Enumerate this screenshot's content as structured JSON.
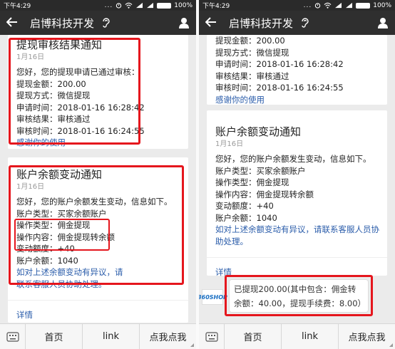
{
  "status_bar": {
    "time": "下午4:29",
    "dots": "...",
    "battery": "100%"
  },
  "nav": {
    "back_icon": "arrow-left",
    "title": "启博科技开发",
    "ear_icon": "ear",
    "profile_icon": "person"
  },
  "left": {
    "card1": {
      "title": "提现审核结果通知",
      "date": "1月16日",
      "lines": [
        "您好，您的提现申请已通过审核：",
        "提现金额：200.00",
        "提现方式：微信提现",
        "申请时间：2018-01-16 16:28:42",
        "审核结果：审核通过",
        "审核时间：2018-01-16 16:24:55"
      ],
      "thanks": "感谢你的使用"
    },
    "card2": {
      "title": "账户余额变动通知",
      "date": "1月16日",
      "lines": [
        "您好，您的账户余额发生变动，信息如下。",
        "账户类型：买家余额账户",
        "操作类型：佣金提现",
        "操作内容：佣金提现转余额",
        "变动额度：+40",
        "账户余额：1040"
      ],
      "notice": "如对上述余额变动有异议，请联系客服人员协助处理。",
      "detail": "详情"
    }
  },
  "right": {
    "card1_tail": {
      "lines": [
        "提现金额：200.00",
        "提现方式：微信提现",
        "申请时间：2018-01-16 16:28:42",
        "审核结果：审核通过",
        "审核时间：2018-01-16 16:24:55"
      ],
      "thanks": "感谢你的使用"
    },
    "card2": {
      "title": "账户余额变动通知",
      "date": "1月16日",
      "lines": [
        "您好，您的账户余额发生变动，信息如下。",
        "账户类型：买家余额账户",
        "操作类型：佣金提现",
        "操作内容：佣金提现转余额",
        "变动额度：+40",
        "账户余额：1040"
      ],
      "notice": "如对上述余额变动有异议，请联系客服人员协助处理。",
      "detail": "详情"
    },
    "toast": {
      "shop_label": "360SHOP",
      "line1": "已提现200.00(其中包含：佣金转",
      "line2": "余额：40.00，提现手续费：8.00）"
    }
  },
  "bottom_menu": {
    "keyboard_icon": "keyboard",
    "items": [
      "首页",
      "link",
      "点我点我"
    ]
  },
  "colors": {
    "highlight": "#e5161d",
    "link": "#2a5caa",
    "navbar": "#2f2f2f"
  }
}
